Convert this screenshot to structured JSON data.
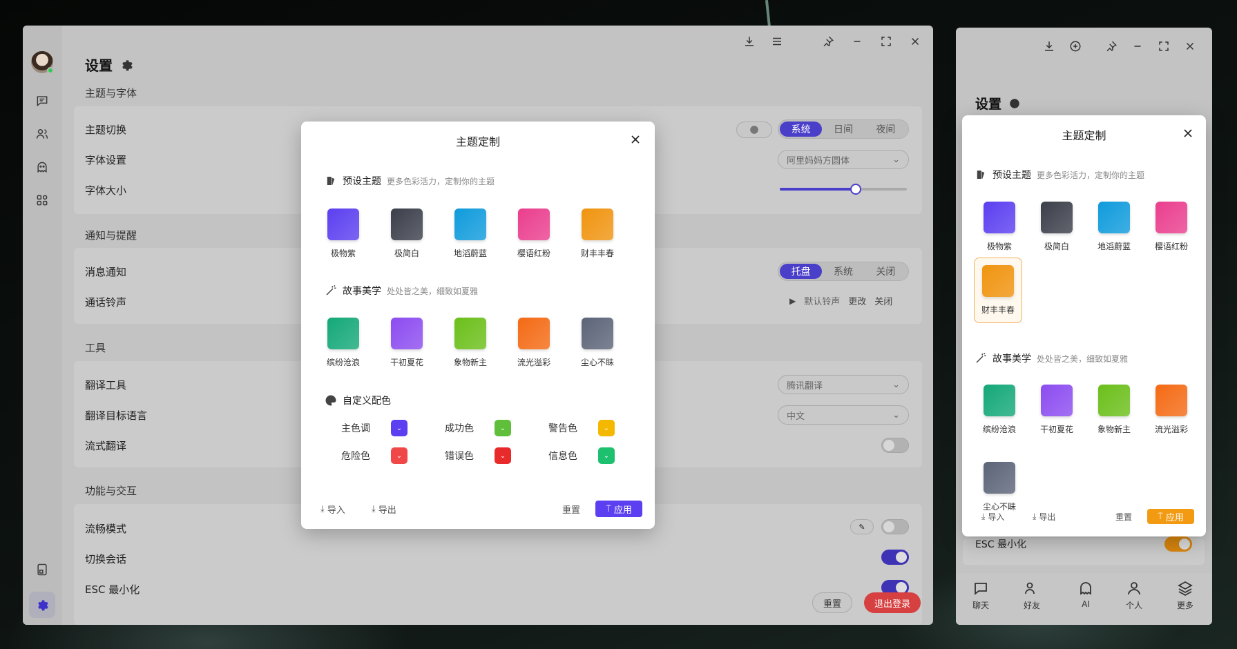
{
  "main": {
    "page_title": "设置",
    "sections": {
      "theme": "主题与字体",
      "notify": "通知与提醒",
      "tools": "工具",
      "function": "功能与交互"
    },
    "rows": {
      "theme_switch": "主题切换",
      "font_setting": "字体设置",
      "font_size": "字体大小",
      "msg_notify": "消息通知",
      "ringtone": "通话铃声",
      "translate_tool": "翻译工具",
      "translate_target": "翻译目标语言",
      "stream_translate": "流式翻译",
      "smooth_mode": "流畅模式",
      "switch_session": "切换会话",
      "esc_min": "ESC 最小化"
    },
    "theme_seg": [
      "系统",
      "日间",
      "夜间"
    ],
    "font_select": "阿里妈妈方圆体",
    "font_size_value": 0.6,
    "notify_seg": [
      "托盘",
      "系统",
      "关闭"
    ],
    "ringtone": {
      "name": "默认铃声",
      "change": "更改",
      "close": "关闭"
    },
    "translate_tool_value": "腾讯翻译",
    "translate_target_value": "中文",
    "buttons": {
      "reset": "重置",
      "logout": "退出登录"
    }
  },
  "dialog": {
    "title": "主题定制",
    "preset": {
      "title": "预设主题",
      "subtitle": "更多色彩活力，定制你的主题"
    },
    "story": {
      "title": "故事美学",
      "subtitle": "处处皆之美，细致如夏雅"
    },
    "custom": {
      "title": "自定义配色"
    },
    "preset_themes": [
      {
        "name": "极物紫",
        "color": "#5b3ff0"
      },
      {
        "name": "极简白",
        "color": "#3b3f4a"
      },
      {
        "name": "地滔蔚蓝",
        "color": "#0f9bdc"
      },
      {
        "name": "樱语红粉",
        "color": "#ea3e8e"
      },
      {
        "name": "财丰丰春",
        "color": "#f09410"
      }
    ],
    "story_themes": [
      {
        "name": "缤纷沧浪",
        "color": "#14a878"
      },
      {
        "name": "干初夏花",
        "color": "#8c4cf0"
      },
      {
        "name": "象物新主",
        "color": "#6bbf1a"
      },
      {
        "name": "流光溢彩",
        "color": "#f46a14"
      },
      {
        "name": "尘心不眛",
        "color": "#5c6478"
      }
    ],
    "custom_colors": [
      {
        "label": "主色调",
        "color": "#5b3ff0"
      },
      {
        "label": "成功色",
        "color": "#5fbf3a"
      },
      {
        "label": "警告色",
        "color": "#f5b800"
      },
      {
        "label": "危险色",
        "color": "#f04848"
      },
      {
        "label": "错误色",
        "color": "#e82a2a"
      },
      {
        "label": "信息色",
        "color": "#1cc06e"
      }
    ],
    "footer": {
      "import": "导入",
      "export": "导出",
      "reset": "重置",
      "apply": "应用"
    }
  },
  "side": {
    "page_title": "设置",
    "esc_row": "ESC 最小化",
    "dialog_title": "主题定制",
    "nav": [
      "聊天",
      "好友",
      "AI",
      "个人",
      "更多"
    ]
  },
  "colors": {
    "accent": "#4a3fc9",
    "accent_side": "#f29a12",
    "danger": "#d64040"
  }
}
